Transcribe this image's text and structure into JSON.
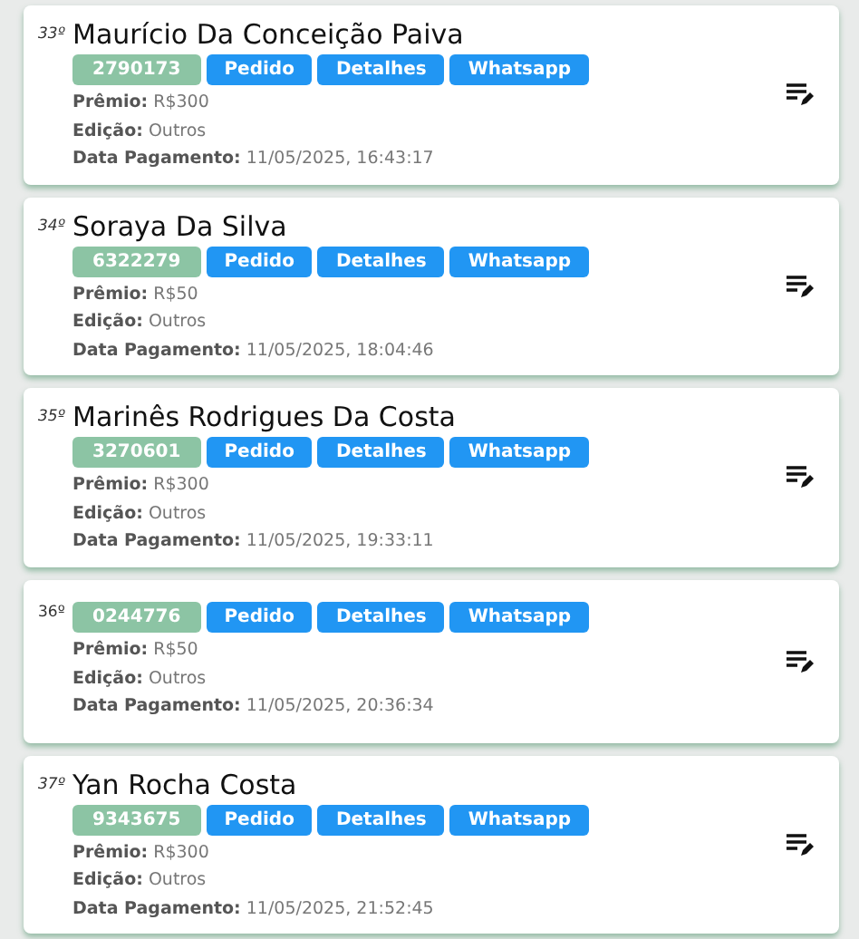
{
  "cards": [
    {
      "rank": "33º",
      "name": "Maurício Da Conceição Paiva",
      "code": "2790173",
      "actions": [
        "Pedido",
        "Detalhes",
        "Whatsapp"
      ],
      "fields": [
        {
          "label": "Prêmio:",
          "value": "R$300"
        },
        {
          "label": "Edição:",
          "value": "Outros"
        },
        {
          "label": "Data Pagamento:",
          "value": "11/05/2025, 16:43:17"
        }
      ]
    },
    {
      "rank": "34º",
      "name": "Soraya Da Silva",
      "code": "6322279",
      "actions": [
        "Pedido",
        "Detalhes",
        "Whatsapp"
      ],
      "fields": [
        {
          "label": "Prêmio:",
          "value": "R$50"
        },
        {
          "label": "Edição:",
          "value": "Outros"
        },
        {
          "label": "Data Pagamento:",
          "value": "11/05/2025, 18:04:46"
        }
      ]
    },
    {
      "rank": "35º",
      "name": "Marinês Rodrigues Da Costa",
      "code": "3270601",
      "actions": [
        "Pedido",
        "Detalhes",
        "Whatsapp"
      ],
      "fields": [
        {
          "label": "Prêmio:",
          "value": "R$300"
        },
        {
          "label": "Edição:",
          "value": "Outros"
        },
        {
          "label": "Data Pagamento:",
          "value": "11/05/2025, 19:33:11"
        }
      ]
    },
    {
      "rank": "36º",
      "code": "0244776",
      "actions": [
        "Pedido",
        "Detalhes",
        "Whatsapp"
      ],
      "fields": [
        {
          "label": "Prêmio:",
          "value": "R$50"
        },
        {
          "label": "Edição:",
          "value": "Outros"
        },
        {
          "label": "Data Pagamento:",
          "value": "11/05/2025, 20:36:34"
        }
      ]
    },
    {
      "rank": "37º",
      "name": "Yan Rocha Costa",
      "code": "9343675",
      "actions": [
        "Pedido",
        "Detalhes",
        "Whatsapp"
      ],
      "fields": [
        {
          "label": "Prêmio:",
          "value": "R$300"
        },
        {
          "label": "Edição:",
          "value": "Outros"
        },
        {
          "label": "Data Pagamento:",
          "value": "11/05/2025, 21:52:45"
        }
      ]
    }
  ]
}
